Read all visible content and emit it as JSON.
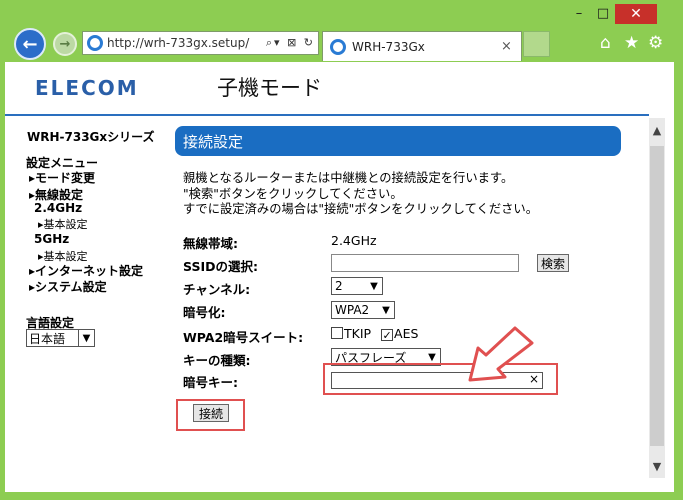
{
  "browser": {
    "window_controls": {
      "minimize": "–",
      "maximize": "□",
      "close": "✕"
    },
    "url": "http://wrh-733gx.setup/",
    "addr_tools": "⌕▾ ⊠ ↻",
    "tab_title": "WRH-733Gx",
    "tab_close": "×",
    "tools": {
      "home": "⌂",
      "favorites": "★",
      "settings": "⚙"
    }
  },
  "header": {
    "logo": "ELECOM",
    "title": "子機モード"
  },
  "sidebar": {
    "model": "WRH-733Gxシリーズ",
    "menu_title": "設定メニュー",
    "items": [
      {
        "label": "▸モード変更"
      },
      {
        "label": "▸無線設定"
      },
      {
        "label": "2.4GHz"
      },
      {
        "label": "▸基本設定"
      },
      {
        "label": "5GHz"
      },
      {
        "label": "▸基本設定"
      },
      {
        "label": "▸インターネット設定"
      },
      {
        "label": "▸システム設定"
      }
    ],
    "language_label": "言語設定",
    "language_value": "日本語"
  },
  "main": {
    "section_title": "接続設定",
    "desc": [
      "親機となるルーターまたは中継機との接続設定を行います。",
      "\"検索\"ボタンをクリックしてください。",
      "すでに設定済みの場合は\"接続\"ボタンをクリックしてください。"
    ],
    "band_label": "無線帯域:",
    "band_value": "2.4GHz",
    "ssid_label": "SSIDの選択:",
    "search_button": "検索",
    "channel_label": "チャンネル:",
    "channel_value": "2",
    "encryption_label": "暗号化:",
    "encryption_value": "WPA2",
    "suite_label": "WPA2暗号スイート:",
    "tkip_label": "TKIP",
    "aes_label": "AES",
    "key_type_label": "キーの種類:",
    "key_type_value": "パスフレーズ",
    "key_label": "暗号キー:",
    "key_clear": "×",
    "connect_button": "接続"
  },
  "colors": {
    "frame": "#8dcd52",
    "accent": "#1a6dc2",
    "highlight": "#e05050"
  }
}
